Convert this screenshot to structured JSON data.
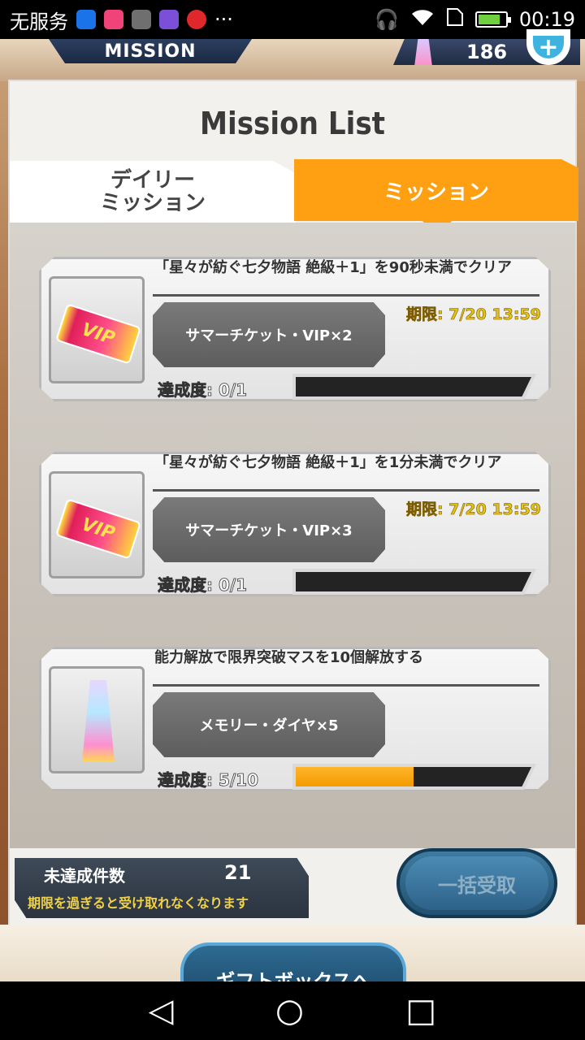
{
  "status_bar": {
    "carrier": "无服务",
    "time": "00:19",
    "app_icons": [
      {
        "name": "dukpt-app-icon",
        "color": "#1a73e8"
      },
      {
        "name": "game-app-icon",
        "color": "#f0437a"
      },
      {
        "name": "gallery-app-icon",
        "color": "#6f6f6f"
      },
      {
        "name": "keyboard-app-icon",
        "color": "#7b4fd8"
      },
      {
        "name": "music-app-icon",
        "color": "#e0282c"
      }
    ],
    "more": "···"
  },
  "header": {
    "tab_label": "MISSION",
    "currency_value": "186",
    "plus": "+"
  },
  "panel": {
    "title": "Mission List",
    "tabs": {
      "daily": "デイリー\nミッション",
      "mission": "ミッション"
    }
  },
  "missions": [
    {
      "title": "「星々が紡ぐ七夕物語 絶級＋1」を90秒未満でクリア",
      "reward": "サマーチケット・VIP×2",
      "deadline": "期限: 7/20 13:59",
      "progress_label": "達成度: 0/1",
      "progress": 0,
      "icon": "vip-ticket-icon",
      "icon_text": "VIP"
    },
    {
      "title": "「星々が紡ぐ七夕物語 絶級＋1」を1分未満でクリア",
      "reward": "サマーチケット・VIP×3",
      "deadline": "期限: 7/20 13:59",
      "progress_label": "達成度: 0/1",
      "progress": 0,
      "icon": "vip-ticket-icon",
      "icon_text": "VIP"
    },
    {
      "title": "能力解放で限界突破マスを10個解放する",
      "reward": "メモリー・ダイヤ×5",
      "deadline": "",
      "progress_label": "達成度: 5/10",
      "progress": 0.5,
      "icon": "memory-diamond-icon",
      "icon_text": ""
    }
  ],
  "footer": {
    "pending_label": "未達成件数",
    "pending_count": "21",
    "pending_note": "期限を過ぎると受け取れなくなります",
    "claim_all": "一括受取",
    "gift_box": "ギフトボックスへ"
  },
  "nav": {
    "back": "◁",
    "home": "○",
    "recent": "□"
  },
  "colors": {
    "accent": "#ff9f12",
    "deadline": "#e4c318",
    "progress": "#f39a00"
  }
}
